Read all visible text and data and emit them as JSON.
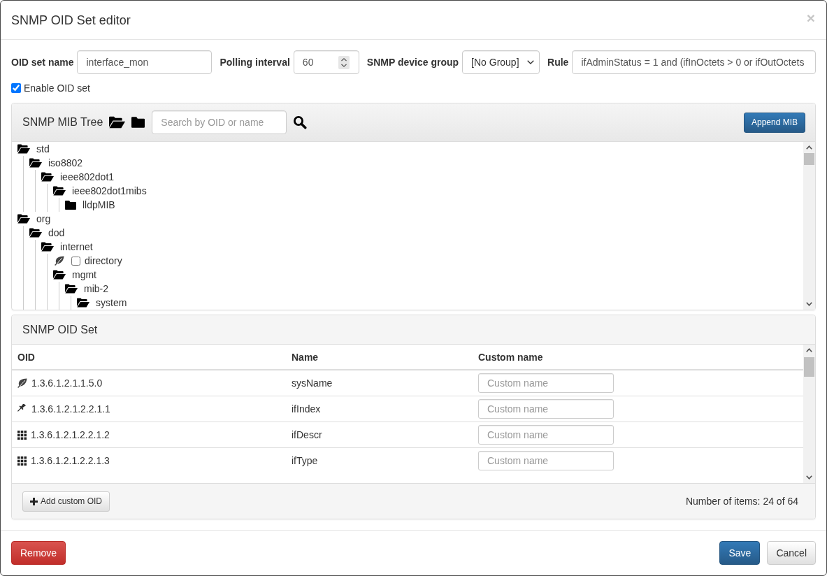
{
  "window": {
    "title": "SNMP OID Set editor",
    "close": "×"
  },
  "form": {
    "fields": [
      {
        "kind": "text",
        "label": "OID set name",
        "value": "interface_mon"
      },
      {
        "kind": "number",
        "label": "Polling interval",
        "value": "60"
      },
      {
        "kind": "select",
        "label": "SNMP device group",
        "value": "[No Group]"
      },
      {
        "kind": "text",
        "label": "Rule",
        "value": "ifAdminStatus = 1 and (ifInOctets > 0 or ifOutOctets"
      }
    ],
    "enable": {
      "label": "Enable OID set",
      "checked": true
    }
  },
  "mib_tree": {
    "title": "SNMP MIB Tree",
    "search": {
      "placeholder": "Search by OID or name"
    },
    "append_button": "Append MIB",
    "nodes": [
      {
        "kind": "folder",
        "label": "std",
        "expanded": true,
        "children": [
          {
            "kind": "folder",
            "label": "iso8802",
            "expanded": true,
            "children": [
              {
                "kind": "folder",
                "label": "ieee802dot1",
                "expanded": true,
                "children": [
                  {
                    "kind": "folder",
                    "label": "ieee802dot1mibs",
                    "expanded": true,
                    "children": [
                      {
                        "kind": "folder",
                        "label": "lldpMIB",
                        "expanded": false
                      }
                    ]
                  }
                ]
              }
            ]
          }
        ]
      },
      {
        "kind": "folder",
        "label": "org",
        "expanded": true,
        "children": [
          {
            "kind": "folder",
            "label": "dod",
            "expanded": true,
            "children": [
              {
                "kind": "folder",
                "label": "internet",
                "expanded": true,
                "children": [
                  {
                    "kind": "leaf",
                    "label": "directory",
                    "checked": false
                  },
                  {
                    "kind": "folder",
                    "label": "mgmt",
                    "expanded": true,
                    "children": [
                      {
                        "kind": "folder",
                        "label": "mib-2",
                        "expanded": true,
                        "children": [
                          {
                            "kind": "folder",
                            "label": "system",
                            "expanded": true
                          }
                        ]
                      }
                    ]
                  }
                ]
              }
            ]
          }
        ]
      }
    ]
  },
  "oid_set": {
    "title": "SNMP OID Set",
    "columns": [
      "OID",
      "Name",
      "Custom name"
    ],
    "rows": [
      {
        "kind": "scalar",
        "oid": "1.3.6.1.2.1.1.5.0",
        "name": "sysName",
        "custom_name": {
          "placeholder": "Custom name"
        }
      },
      {
        "kind": "index",
        "oid": "1.3.6.1.2.1.2.2.1.1",
        "name": "ifIndex",
        "custom_name": {
          "placeholder": "Custom name"
        }
      },
      {
        "kind": "column",
        "oid": "1.3.6.1.2.1.2.2.1.2",
        "name": "ifDescr",
        "custom_name": {
          "placeholder": "Custom name"
        }
      },
      {
        "kind": "column",
        "oid": "1.3.6.1.2.1.2.2.1.3",
        "name": "ifType",
        "custom_name": {
          "placeholder": "Custom name"
        }
      }
    ],
    "add_button": "Add custom OID",
    "count": "Number of items: 24 of 64"
  },
  "footer": {
    "buttons": [
      {
        "kind": "danger",
        "label": "Remove"
      },
      {
        "kind": "primary",
        "label": "Save"
      },
      {
        "kind": "default",
        "label": "Cancel"
      }
    ]
  }
}
